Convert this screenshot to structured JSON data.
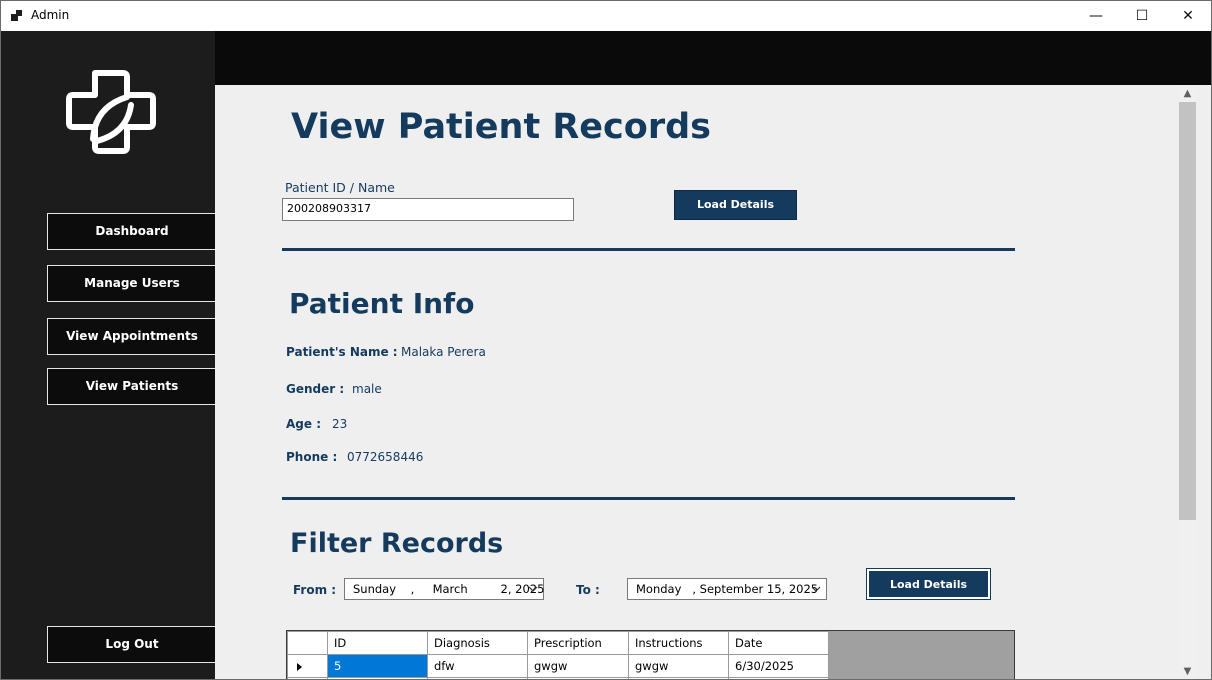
{
  "window": {
    "title": "Admin",
    "minimize_glyph": "—",
    "maximize_glyph": "☐",
    "close_glyph": "✕"
  },
  "sidebar": {
    "logo_icon": "medical-cross-leaf-icon",
    "items": [
      {
        "label": "Dashboard"
      },
      {
        "label": "Manage Users"
      },
      {
        "label": "View Appointments"
      },
      {
        "label": "View Patients"
      }
    ],
    "logout_label": "Log Out"
  },
  "main": {
    "page_title": "View Patient Records",
    "search": {
      "label": "Patient ID / Name",
      "value": "200208903317"
    },
    "load_button_label": "Load Details",
    "patient_info": {
      "heading": "Patient Info",
      "name_label": "Patient's Name :",
      "name_value": "Malaka Perera",
      "gender_label": "Gender :",
      "gender_value": "male",
      "age_label": "Age :",
      "age_value": "23",
      "phone_label": "Phone :",
      "phone_value": "0772658446"
    },
    "filter": {
      "heading": "Filter Records",
      "from_label": "From :",
      "from_value": "Sunday    ,     March         2, 2025",
      "to_label": "To :",
      "to_value": "Monday   , September 15, 2025",
      "load_button_label": "Load Details"
    },
    "records_table": {
      "columns": [
        "ID",
        "Diagnosis",
        "Prescription",
        "Instructions",
        "Date"
      ],
      "rows": [
        [
          "5",
          "dfw",
          "gwgw",
          "gwgw",
          "6/30/2025"
        ]
      ]
    }
  },
  "colors": {
    "accent": "#143a5e",
    "sidebar_bg": "#1c1c1c",
    "content_bg": "#efefef",
    "selection": "#0078d7"
  }
}
